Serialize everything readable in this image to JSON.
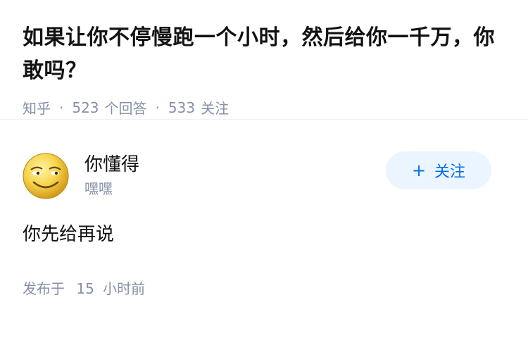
{
  "question": {
    "title": "如果让你不停慢跑一个小时，然后给你一千万，你敢吗？",
    "source": "知乎",
    "separator": "·",
    "answer_count": "523",
    "answer_label": "个回答",
    "follow_count": "533",
    "follow_label": "关注"
  },
  "answer": {
    "author_name": "你懂得",
    "author_bio": "嘿嘿",
    "avatar_icon": "smiley-face-icon",
    "follow_button": {
      "plus": "+",
      "label": "关注"
    },
    "content": "你先给再说",
    "time_prefix": "发布于",
    "time_value": "15",
    "time_unit": "小时前"
  },
  "colors": {
    "title": "#121212",
    "meta": "#8590a6",
    "accent": "#056de8",
    "follow_bg": "#ebf5ff"
  }
}
